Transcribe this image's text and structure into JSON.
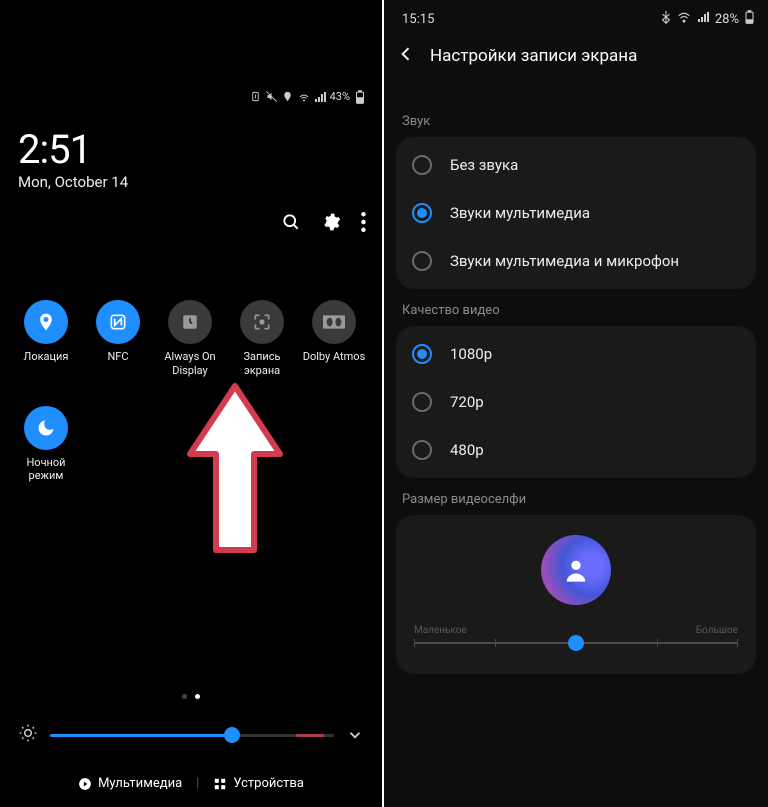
{
  "left": {
    "status": {
      "battery": "43%"
    },
    "clock": {
      "time": "2:51",
      "date": "Mon, October 14"
    },
    "tiles": [
      {
        "id": "location",
        "label": "Локация",
        "on": true,
        "icon": "pin"
      },
      {
        "id": "nfc",
        "label": "NFC",
        "on": true,
        "icon": "nfc"
      },
      {
        "id": "aod",
        "label": "Always On Display",
        "on": false,
        "icon": "clock-square"
      },
      {
        "id": "screenrec",
        "label": "Запись экрана",
        "on": false,
        "icon": "screen-record"
      },
      {
        "id": "dolby",
        "label": "Dolby Atmos",
        "on": false,
        "icon": "dolby"
      },
      {
        "id": "night",
        "label": "Ночной режим",
        "on": true,
        "icon": "moon"
      }
    ],
    "pages": {
      "count": 2,
      "active": 1
    },
    "brightness_pct": 64,
    "bottom": {
      "media_label": "Мультимедиа",
      "devices_label": "Устройства"
    }
  },
  "right": {
    "status": {
      "time": "15:15",
      "battery": "28%"
    },
    "title": "Настройки записи экрана",
    "sections": {
      "sound": {
        "label": "Звук",
        "options": [
          {
            "label": "Без звука",
            "selected": false
          },
          {
            "label": "Звуки мультимедиа",
            "selected": true
          },
          {
            "label": "Звуки мультимедиа и микрофон",
            "selected": false
          }
        ]
      },
      "quality": {
        "label": "Качество видео",
        "options": [
          {
            "label": "1080p",
            "selected": true
          },
          {
            "label": "720p",
            "selected": false
          },
          {
            "label": "480p",
            "selected": false
          }
        ]
      },
      "selfie": {
        "label": "Размер видеоселфи",
        "slider_min_label": "Маленькое",
        "slider_max_label": "Большое",
        "slider_pct": 50
      }
    }
  }
}
